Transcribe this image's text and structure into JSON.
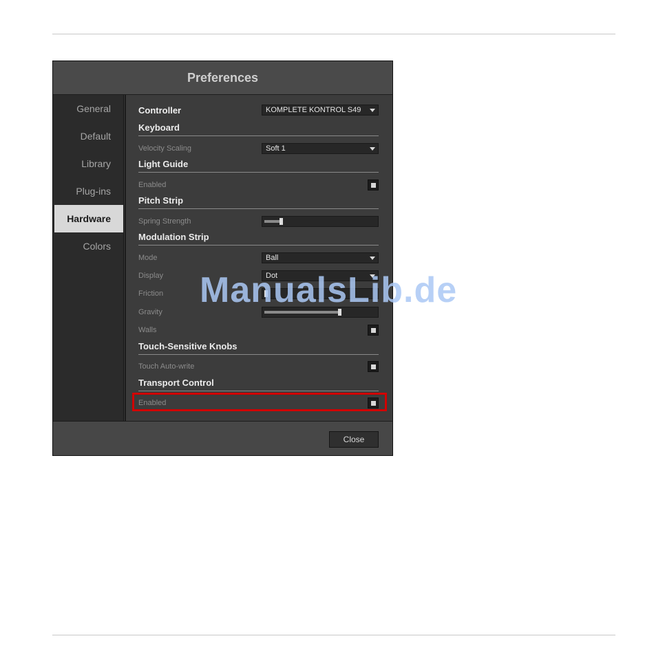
{
  "window": {
    "title": "Preferences"
  },
  "sidebar": {
    "items": [
      {
        "label": "General",
        "active": false
      },
      {
        "label": "Default",
        "active": false
      },
      {
        "label": "Library",
        "active": false
      },
      {
        "label": "Plug-ins",
        "active": false
      },
      {
        "label": "Hardware",
        "active": true
      },
      {
        "label": "Colors",
        "active": false
      }
    ]
  },
  "controller": {
    "label": "Controller",
    "value": "KOMPLETE KONTROL S49"
  },
  "keyboard": {
    "heading": "Keyboard",
    "velocity_label": "Velocity Scaling",
    "velocity_value": "Soft 1"
  },
  "light_guide": {
    "heading": "Light Guide",
    "enabled_label": "Enabled",
    "enabled": true
  },
  "pitch_strip": {
    "heading": "Pitch Strip",
    "spring_label": "Spring Strength",
    "spring_level": 0.14
  },
  "modulation_strip": {
    "heading": "Modulation Strip",
    "mode_label": "Mode",
    "mode_value": "Ball",
    "display_label": "Display",
    "display_value": "Dot",
    "friction_label": "Friction",
    "friction_level": 0.0,
    "gravity_label": "Gravity",
    "gravity_level": 0.68,
    "walls_label": "Walls",
    "walls": true
  },
  "touch_knobs": {
    "heading": "Touch-Sensitive Knobs",
    "autowrite_label": "Touch Auto-write",
    "autowrite": true
  },
  "transport": {
    "heading": "Transport Control",
    "enabled_label": "Enabled",
    "enabled": true
  },
  "footer": {
    "close_label": "Close"
  },
  "watermark": {
    "text": "ManualsLib.de"
  },
  "colors": {
    "highlight": "#d20000",
    "active_tab": "#d8d8d8"
  }
}
